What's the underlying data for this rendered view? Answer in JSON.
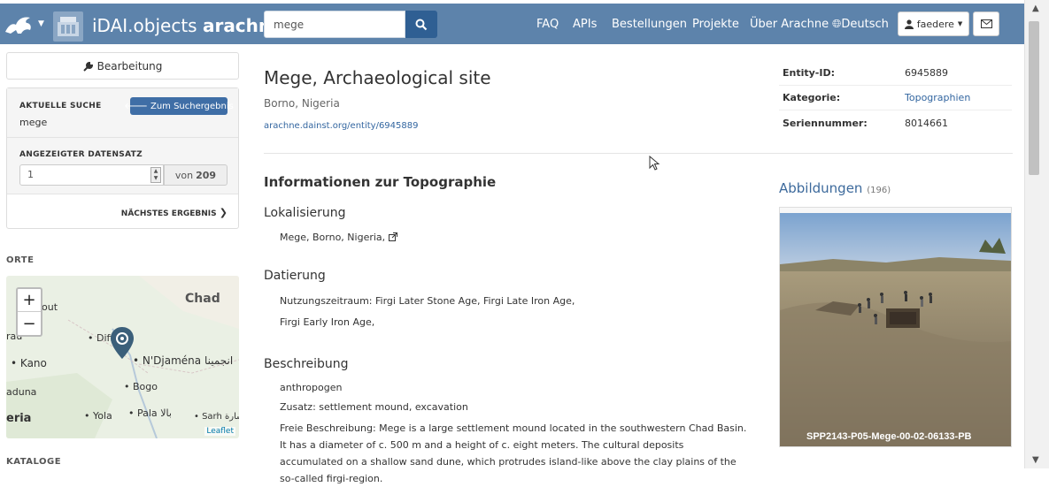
{
  "navbar": {
    "brand_light": "iDAI.objects ",
    "brand_bold": "arachne",
    "search_value": "mege",
    "links": [
      "FAQ",
      "APIs",
      "Bestellungen",
      "Projekte",
      "Über Arachne"
    ],
    "language": "Deutsch",
    "user": "faedere"
  },
  "sidebar": {
    "edit_label": "Bearbeitung",
    "current_search_label": "AKTUELLE SUCHE",
    "current_search_value": "mege",
    "to_results_label": "Zum Suchergebnis",
    "shown_record_label": "ANGEZEIGTER DATENSATZ",
    "record_number": "1",
    "von_label": "von",
    "total": "209",
    "next_label": "NÄCHSTES ERGEBNIS",
    "places_heading": "ORTE",
    "catalogs_heading": "KATALOGE",
    "map": {
      "chad": "Chad",
      "out": "out",
      "rau": "rau",
      "diffa": "Diff",
      "kano": "Kano",
      "ndjamena": "N'Djaména انجمينا",
      "bogo": "Bogo",
      "aduna": "aduna",
      "eria": "eria",
      "yola": "Yola",
      "pala": "Pala بالا",
      "sarh": "Sarh سارة",
      "zoom_in": "+",
      "zoom_out": "−",
      "attribution": "Leaflet"
    }
  },
  "entity": {
    "title": "Mege, Archaeological site",
    "location": "Borno, Nigeria",
    "link": "arachne.dainst.org/entity/6945889",
    "meta": [
      {
        "key": "Entity-ID:",
        "value": "6945889"
      },
      {
        "key": "Kategorie:",
        "value": "Topographien"
      },
      {
        "key": "Seriennummer:",
        "value": "8014661"
      }
    ]
  },
  "content": {
    "section_title": "Informationen zur Topographie",
    "lokalisierung_title": "Lokalisierung",
    "lokalisierung_value": "Mege, Borno, Nigeria,",
    "datierung_title": "Datierung",
    "datierung_line1": "Nutzungszeitraum: Firgi Later Stone Age, Firgi Late Iron Age,",
    "datierung_line2": "Firgi Early Iron Age,",
    "beschreibung_title": "Beschreibung",
    "beschreibung_line1": "anthropogen",
    "beschreibung_line2": "Zusatz: settlement mound, excavation",
    "beschreibung_para": "Freie Beschreibung: Mege is a large settlement mound located in the southwestern Chad Basin. It has a diameter of c. 500 m and a height of c. eight meters. The cultural deposits accumulated on a shallow sand dune, which protrudes island-like above the clay plains of the so-called firgi-region."
  },
  "images": {
    "heading": "Abbildungen",
    "count": "(196)",
    "caption": "SPP2143-P05-Mege-00-02-06133-PB"
  }
}
